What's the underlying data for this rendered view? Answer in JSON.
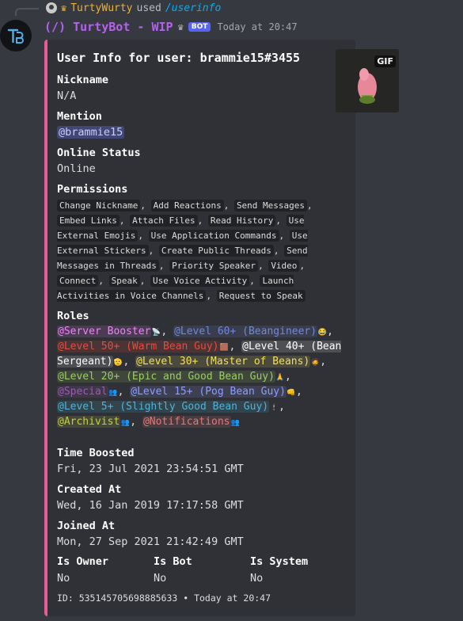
{
  "reply": {
    "avatar_icon": "user-avatar-mini",
    "username": "TurtyWurty",
    "used_text": "used",
    "command": "/userinfo"
  },
  "message": {
    "bot_name": "(/) TurtyBot - WIP",
    "bot_tag": "BOT",
    "timestamp": "Today at 20:47",
    "avatar_icon": "tb-logo-icon",
    "avatar_text": "TB"
  },
  "embed": {
    "accent_color": "#e85a9a",
    "thumbnail_badge": "GIF",
    "title": "User Info for user: brammie15#3455",
    "nickname_label": "Nickname",
    "nickname_value": "N/A",
    "mention_label": "Mention",
    "mention_value": "@brammie15",
    "status_label": "Online Status",
    "status_value": "Online",
    "permissions_label": "Permissions",
    "permissions": [
      "Change Nickname",
      "Add Reactions",
      "Send Messages",
      "Embed Links",
      "Attach Files",
      "Read History",
      "Use External Emojis",
      "Use Application Commands",
      "Use External Stickers",
      "Create Public Threads",
      "Send Messages in Threads",
      "Priority Speaker",
      "Video",
      "Connect",
      "Speak",
      "Use Voice Activity",
      "Launch Activities in Voice Channels",
      "Request to Speak"
    ],
    "roles_label": "Roles",
    "roles": [
      {
        "name": "@Server Booster",
        "color": "#f47fff",
        "emoji": "📡"
      },
      {
        "name": "@Level 60+ (Beangineer)",
        "color": "#7289da",
        "emoji": "😂"
      },
      {
        "name": "@Level 50+ (Warm Bean Guy)",
        "color": "#e74c3c",
        "emoji": "🟫"
      },
      {
        "name": "@Level 40+ (Bean Sergeant)",
        "color": "#ffffff",
        "emoji": "🫡"
      },
      {
        "name": "@Level 30+ (Master of Beans)",
        "color": "#f1e05a",
        "emoji": "🧔"
      },
      {
        "name": "@Level 20+ (Epic and Good Bean Guy)",
        "color": "#9ccc65",
        "emoji": "🙏"
      },
      {
        "name": "@Special",
        "color": "#9b59b6",
        "emoji": "👥"
      },
      {
        "name": "@Level 15+ (Pog Bean Guy)",
        "color": "#8e9cff",
        "emoji": "👊"
      },
      {
        "name": "@Level 5+ (Slightly Good Bean Guy)",
        "color": "#4fb3d9",
        "emoji": "🕯"
      },
      {
        "name": "@Archivist",
        "color": "#c3d13b",
        "emoji": "👥"
      },
      {
        "name": "@Notifications",
        "color": "#e07a7a",
        "emoji": "👥"
      }
    ],
    "boosted_label": "Time Boosted",
    "boosted_value": "Fri, 23 Jul 2021 23:54:51 GMT",
    "created_label": "Created At",
    "created_value": "Wed, 16 Jan 2019 17:17:58 GMT",
    "joined_label": "Joined At",
    "joined_value": "Mon, 27 Sep 2021 21:42:49 GMT",
    "owner_label": "Is Owner",
    "owner_value": "No",
    "bot_label": "Is Bot",
    "bot_value": "No",
    "system_label": "Is System",
    "system_value": "No",
    "footer": "ID: 535145705698885633 • Today at 20:47"
  }
}
